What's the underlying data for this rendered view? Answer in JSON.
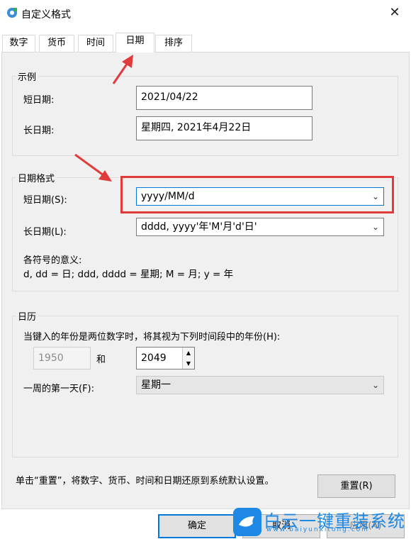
{
  "window": {
    "title": "自定义格式",
    "close_glyph": "✕"
  },
  "tabs": [
    {
      "label": "数字",
      "active": false
    },
    {
      "label": "货币",
      "active": false
    },
    {
      "label": "时间",
      "active": false
    },
    {
      "label": "日期",
      "active": true
    },
    {
      "label": "排序",
      "active": false
    }
  ],
  "example": {
    "group_label": "示例",
    "short_label": "短日期:",
    "short_value": "2021/04/22",
    "long_label": "长日期:",
    "long_value": "星期四, 2021年4月22日"
  },
  "date_format": {
    "group_label": "日期格式",
    "short_label": "短日期(S):",
    "short_value": "yyyy/MM/d",
    "long_label": "长日期(L):",
    "long_value": "dddd, yyyy'年'M'月'd'日'",
    "meaning_title": "各符号的意义:",
    "meaning_text": "d, dd = 日;  ddd, dddd = 星期;  M = 月;  y = 年"
  },
  "calendar": {
    "group_label": "日历",
    "two_digit_text": "当键入的年份是两位数字时，将其视为下列时间段中的年份(H):",
    "year_start": "1950",
    "and_label": "和",
    "year_end": "2049",
    "first_day_label": "一周的第一天(F):",
    "first_day_value": "星期一"
  },
  "footer": {
    "reset_text": "单击“重置”，将数字、货币、时间和日期还原到系统默认设置。",
    "reset_button": "重置(R)",
    "ok_button": "确定",
    "cancel_button": "取消",
    "apply_button": "应用(A)"
  },
  "watermark": {
    "text": "白云一键重装系统",
    "sub": "www.baiyunxitong.com"
  },
  "colors": {
    "accent": "#0078d7",
    "highlight_red": "#e03a3a",
    "panel_bg": "#f0f0f0"
  }
}
